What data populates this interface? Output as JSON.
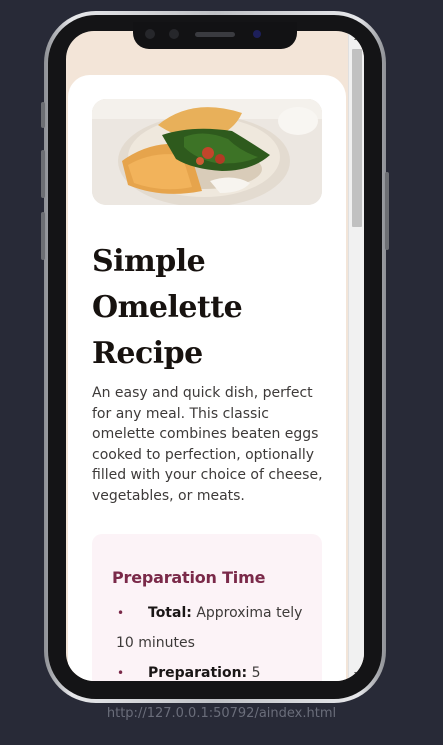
{
  "recipe": {
    "title_lines": [
      "Simple",
      "Omelette",
      "Recipe"
    ],
    "description": "An easy and quick dish, perfect for any meal. This classic omelette combines beaten eggs cooked to perfection, optionally filled with your choice of cheese, vegetables, or meats.",
    "hero_image_alt": "omelette with spinach on a plate"
  },
  "preparation": {
    "heading": "Preparation Time",
    "items": [
      {
        "label": "Total:",
        "value_line1": "Approxima tely",
        "value_line2": "10 minutes"
      },
      {
        "label": "Preparation:",
        "value_line1": "5"
      }
    ]
  },
  "browser": {
    "url": "http://127.0.0.1:50792/aindex.html"
  },
  "colors": {
    "background": "#282a37",
    "accent": "#7a2949",
    "card": "#ffffff",
    "prep_bg": "#fcf3f7"
  }
}
